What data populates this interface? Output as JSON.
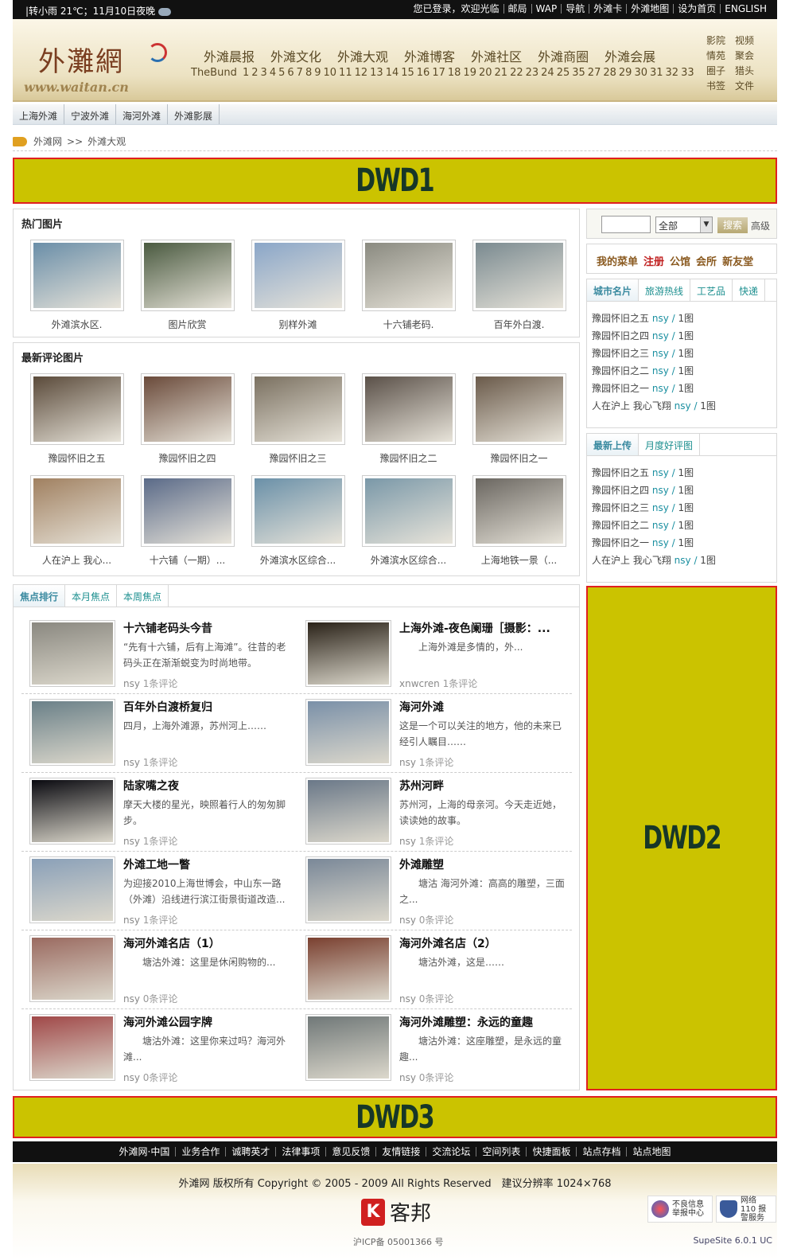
{
  "topbar": {
    "weather": "|转小雨 21℃；11月10日夜晚",
    "links": [
      "您已登录，欢迎光临",
      "邮局",
      "WAP",
      "导航",
      "外滩卡",
      "外滩地图",
      "设为首页",
      "ENGLISH"
    ]
  },
  "header": {
    "logo_cn": "外灘網",
    "logo_url": "www.waitan.cn",
    "nav": [
      "外滩晨报",
      "外滩文化",
      "外滩大观",
      "外滩博客",
      "外滩社区",
      "外滩商圈",
      "外滩会展"
    ],
    "bund_label": "TheBund",
    "bund_numbers": [
      "1",
      "2",
      "3",
      "4",
      "5",
      "6",
      "7",
      "8",
      "9",
      "10",
      "11",
      "12",
      "13",
      "14",
      "15",
      "16",
      "17",
      "18",
      "19",
      "20",
      "21",
      "22",
      "23",
      "24",
      "25",
      "35",
      "27",
      "28",
      "29",
      "30",
      "31",
      "32",
      "33"
    ],
    "side_links": [
      "影院",
      "视频",
      "情苑",
      "聚会",
      "圈子",
      "猎头",
      "书签",
      "文件"
    ]
  },
  "subnav": [
    "上海外滩",
    "宁波外滩",
    "海河外滩",
    "外滩影展"
  ],
  "breadcrumb": {
    "home": "外滩网",
    "sep": ">>",
    "current": "外滩大观"
  },
  "ads": {
    "dwd1": "DWD1",
    "dwd2": "DWD2",
    "dwd3": "DWD3"
  },
  "hot_pictures": {
    "title": "热门图片",
    "items": [
      {
        "caption": "外滩滨水区.",
        "color": "#6a8ea8"
      },
      {
        "caption": "图片欣赏",
        "color": "#4a5a40"
      },
      {
        "caption": "别样外滩",
        "color": "#8aa6c8"
      },
      {
        "caption": "十六铺老码.",
        "color": "#8a8a80"
      },
      {
        "caption": "百年外白渡.",
        "color": "#7a8a90"
      }
    ]
  },
  "latest_comment_pictures": {
    "title": "最新评论图片",
    "items": [
      {
        "caption": "豫园怀旧之五",
        "color": "#5a4a3a"
      },
      {
        "caption": "豫园怀旧之四",
        "color": "#6a4a3a"
      },
      {
        "caption": "豫园怀旧之三",
        "color": "#7a7060"
      },
      {
        "caption": "豫园怀旧之二",
        "color": "#5a5048"
      },
      {
        "caption": "豫园怀旧之一",
        "color": "#6a5a4a"
      },
      {
        "caption": "人在沪上 我心...",
        "color": "#a08060"
      },
      {
        "caption": "十六铺（一期）...",
        "color": "#5a6a88"
      },
      {
        "caption": "外滩滨水区综合...",
        "color": "#6a90a8"
      },
      {
        "caption": "外滩滨水区综合...",
        "color": "#7a98a8"
      },
      {
        "caption": "上海地铁一景（...",
        "color": "#6a6660"
      }
    ]
  },
  "search": {
    "value": "",
    "select": "全部",
    "button": "搜索",
    "advanced": "高级"
  },
  "my_menu": {
    "label": "我的菜单",
    "register": "注册",
    "items": [
      "公馆",
      "会所",
      "新友堂"
    ]
  },
  "city_panel": {
    "tabs": [
      "城市名片",
      "旅游热线",
      "工艺品",
      "快递"
    ],
    "items": [
      {
        "title": "豫园怀旧之五",
        "author": "nsy",
        "count": "1图"
      },
      {
        "title": "豫园怀旧之四",
        "author": "nsy",
        "count": "1图"
      },
      {
        "title": "豫园怀旧之三",
        "author": "nsy",
        "count": "1图"
      },
      {
        "title": "豫园怀旧之二",
        "author": "nsy",
        "count": "1图"
      },
      {
        "title": "豫园怀旧之一",
        "author": "nsy",
        "count": "1图"
      },
      {
        "title": "人在沪上 我心飞翔",
        "author": "nsy",
        "count": "1图"
      }
    ]
  },
  "upload_panel": {
    "tabs": [
      "最新上传",
      "月度好评图"
    ],
    "items": [
      {
        "title": "豫园怀旧之五",
        "author": "nsy",
        "count": "1图"
      },
      {
        "title": "豫园怀旧之四",
        "author": "nsy",
        "count": "1图"
      },
      {
        "title": "豫园怀旧之三",
        "author": "nsy",
        "count": "1图"
      },
      {
        "title": "豫园怀旧之二",
        "author": "nsy",
        "count": "1图"
      },
      {
        "title": "豫园怀旧之一",
        "author": "nsy",
        "count": "1图"
      },
      {
        "title": "人在沪上 我心飞翔",
        "author": "nsy",
        "count": "1图"
      }
    ]
  },
  "focus": {
    "tabs": [
      "焦点排行",
      "本月焦点",
      "本周焦点"
    ],
    "items": [
      {
        "title": "十六铺老码头今昔",
        "desc": "“先有十六铺，后有上海滩”。往昔的老码头正在渐渐蜕变为时尚地带。",
        "author": "nsy",
        "comments": "1条评论",
        "color": "#8a8880"
      },
      {
        "title": "上海外滩-夜色阑珊［摄影：...",
        "desc": "　　上海外滩是多情的，外...",
        "author": "xnwcren",
        "comments": "1条评论",
        "color": "#2a2218"
      },
      {
        "title": "百年外白渡桥复归",
        "desc": "四月，上海外滩源，苏州河上……",
        "author": "nsy",
        "comments": "1条评论",
        "color": "#6a8088"
      },
      {
        "title": "海河外滩",
        "desc": "这是一个可以关注的地方，他的未来已经引人瞩目……",
        "author": "nsy",
        "comments": "1条评论",
        "color": "#7a90a8"
      },
      {
        "title": "陆家嘴之夜",
        "desc": "摩天大楼的星光，映照着行人的匆匆脚步。",
        "author": "nsy",
        "comments": "1条评论",
        "color": "#0a0a10"
      },
      {
        "title": "苏州河畔",
        "desc": "苏州河，上海的母亲河。今天走近她，读读她的故事。",
        "author": "nsy",
        "comments": "1条评论",
        "color": "#6a7888"
      },
      {
        "title": "外滩工地一瞥",
        "desc": "为迎接2010上海世博会，中山东一路（外滩）沿线进行滨江街景街道改造...",
        "author": "nsy",
        "comments": "1条评论",
        "color": "#8aa0b8"
      },
      {
        "title": "外滩雕塑",
        "desc": "　　塘沽 海河外滩：高高的雕塑，三面之...",
        "author": "nsy",
        "comments": "0条评论",
        "color": "#7a8898"
      },
      {
        "title": "海河外滩名店（1）",
        "desc": "　　塘沽外滩：这里是休闲购物的...",
        "author": "nsy",
        "comments": "0条评论",
        "color": "#9a6a60"
      },
      {
        "title": "海河外滩名店（2）",
        "desc": "　　塘沽外滩，这是……",
        "author": "nsy",
        "comments": "0条评论",
        "color": "#7a4030"
      },
      {
        "title": "海河外滩公园字牌",
        "desc": "　　塘沽外滩：这里你来过吗？海河外滩...",
        "author": "nsy",
        "comments": "0条评论",
        "color": "#a04848"
      },
      {
        "title": "海河外滩雕塑：永远的童趣",
        "desc": "　　塘沽外滩：这座雕塑，是永远的童趣...",
        "author": "nsy",
        "comments": "0条评论",
        "color": "#707878"
      }
    ]
  },
  "footer": {
    "nav": [
      "外滩网·中国",
      "业务合作",
      "诚聘英才",
      "法律事项",
      "意见反馈",
      "友情链接",
      "交流论坛",
      "空间列表",
      "快捷面板",
      "站点存档",
      "站点地图"
    ],
    "copyright": "外滩网 版权所有 Copyright © 2005 - 2009 All Rights Reserved　建议分辨率 1024×768",
    "sponsor_letter": "K",
    "sponsor_name": "客邦",
    "icp": "沪ICP备 05001366 号",
    "badge1": "不良信息举报中心",
    "badge2": "网络 110 报警服务",
    "version": "SupeSite 6.0.1 UC"
  }
}
